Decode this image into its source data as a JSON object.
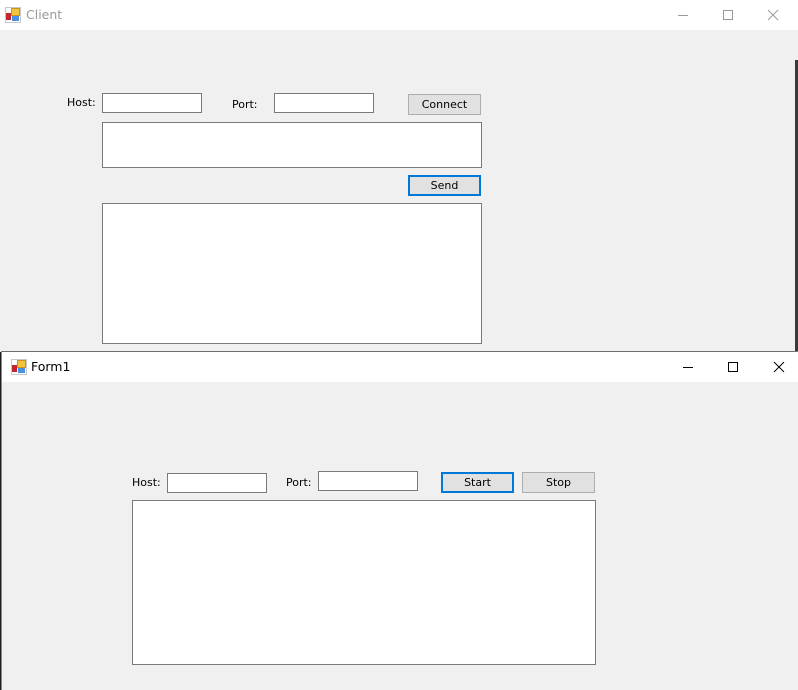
{
  "client_window": {
    "title": "Client",
    "icon": "winforms-app-icon",
    "state": "inactive",
    "caption_buttons": [
      "minimize",
      "maximize",
      "close"
    ],
    "host_label": "Host:",
    "host_value": "",
    "port_label": "Port:",
    "port_value": "",
    "connect_label": "Connect",
    "message_value": "",
    "send_label": "Send",
    "log_value": ""
  },
  "form1_window": {
    "title": "Form1",
    "icon": "winforms-app-icon",
    "state": "active",
    "caption_buttons": [
      "minimize",
      "maximize",
      "close"
    ],
    "host_label": "Host:",
    "host_value": "",
    "port_label": "Port:",
    "port_value": "",
    "start_label": "Start",
    "stop_label": "Stop",
    "log_value": ""
  },
  "colors": {
    "focus_border": "#0078d7",
    "form_background": "#f0f0f0",
    "titlebar_background": "#ffffff"
  }
}
